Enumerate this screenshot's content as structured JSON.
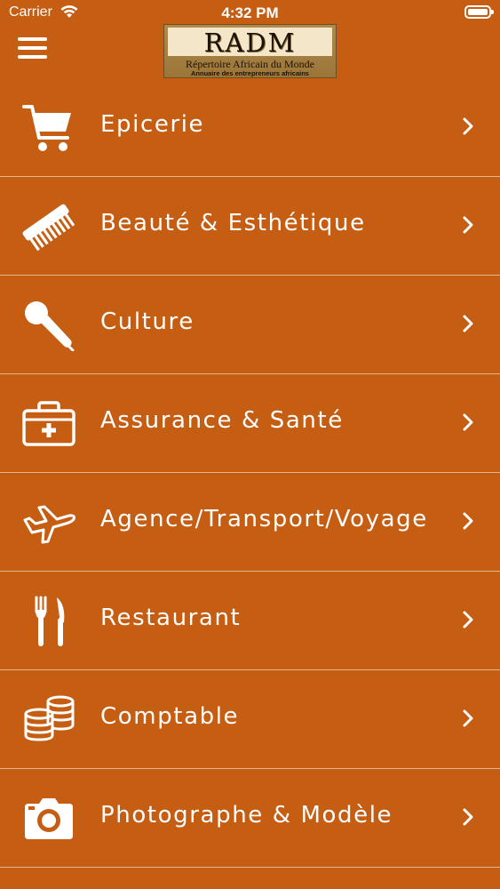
{
  "status_bar": {
    "carrier": "Carrier",
    "time": "4:32 PM"
  },
  "header": {
    "logo_title": "RADM",
    "logo_subtitle": "Répertoire Africain du Monde",
    "logo_tagline": "Annuaire des entrepreneurs africains"
  },
  "colors": {
    "background": "#c55d12",
    "foreground": "#ffffff",
    "divider": "rgba(255,255,255,0.55)"
  },
  "menu": {
    "items": [
      {
        "label": "Epicerie",
        "icon": "shopping-cart-icon"
      },
      {
        "label": "Beauté & Esthétique",
        "icon": "comb-icon"
      },
      {
        "label": "Culture",
        "icon": "microphone-icon"
      },
      {
        "label": "Assurance & Santé",
        "icon": "medical-kit-icon"
      },
      {
        "label": "Agence/Transport/Voyage",
        "icon": "airplane-icon"
      },
      {
        "label": "Restaurant",
        "icon": "fork-knife-icon"
      },
      {
        "label": "Comptable",
        "icon": "coins-icon"
      },
      {
        "label": "Photographe & Modèle",
        "icon": "camera-icon"
      }
    ]
  }
}
